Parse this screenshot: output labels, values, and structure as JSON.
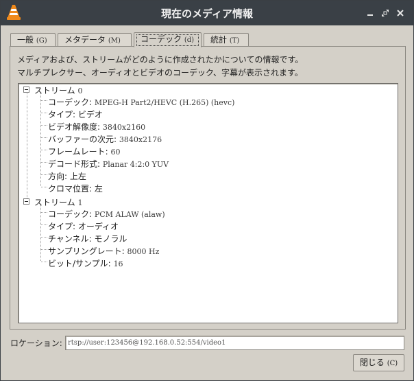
{
  "window": {
    "title": "現在のメディア情報"
  },
  "tabs": [
    {
      "label": "一般",
      "mnemonic": "(G)"
    },
    {
      "label": "メタデータ",
      "mnemonic": "(M)"
    },
    {
      "label": "コーデック",
      "mnemonic": "(d)"
    },
    {
      "label": "統計",
      "mnemonic": "(T)"
    }
  ],
  "active_tab": "コーデック",
  "description": {
    "line1": "メディアおよび、ストリームがどのように作成されたかについての情報です。",
    "line2": "マルチプレクサー、オーディオとビデオのコーデック、字幕が表示されます。"
  },
  "streams": [
    {
      "label": "ストリーム",
      "index": "0",
      "items": [
        {
          "key": "コーデック:",
          "value": "MPEG-H Part2/HEVC (H.265) (hevc)"
        },
        {
          "key": "タイプ:",
          "value": "ビデオ"
        },
        {
          "key": "ビデオ解像度:",
          "value": "3840x2160"
        },
        {
          "key": "バッファーの次元:",
          "value": "3840x2176"
        },
        {
          "key": "フレームレート:",
          "value": "60"
        },
        {
          "key": "デコード形式:",
          "value": "Planar 4:2:0 YUV"
        },
        {
          "key": "方向:",
          "value": "上左"
        },
        {
          "key": "クロマ位置:",
          "value": "左"
        }
      ]
    },
    {
      "label": "ストリーム",
      "index": "1",
      "items": [
        {
          "key": "コーデック:",
          "value": "PCM ALAW (alaw)"
        },
        {
          "key": "タイプ:",
          "value": "オーディオ"
        },
        {
          "key": "チャンネル:",
          "value": "モノラル"
        },
        {
          "key": "サンプリングレート:",
          "value": "8000 Hz"
        },
        {
          "key": "ビット/サンプル:",
          "value": "16"
        }
      ]
    }
  ],
  "location": {
    "label": "ロケーション:",
    "value": "rtsp://user:123456@192.168.0.52:554/video1"
  },
  "close_button": {
    "label": "閉じる",
    "mnemonic": "(C)"
  },
  "colors": {
    "titlebar": "#3a4046",
    "window_bg": "#d4d0c8",
    "vlc_orange": "#f08a1c"
  },
  "icons": {
    "app": "vlc-cone-icon",
    "minimize": "minimize-icon",
    "restore": "restore-icon",
    "close": "close-icon"
  }
}
